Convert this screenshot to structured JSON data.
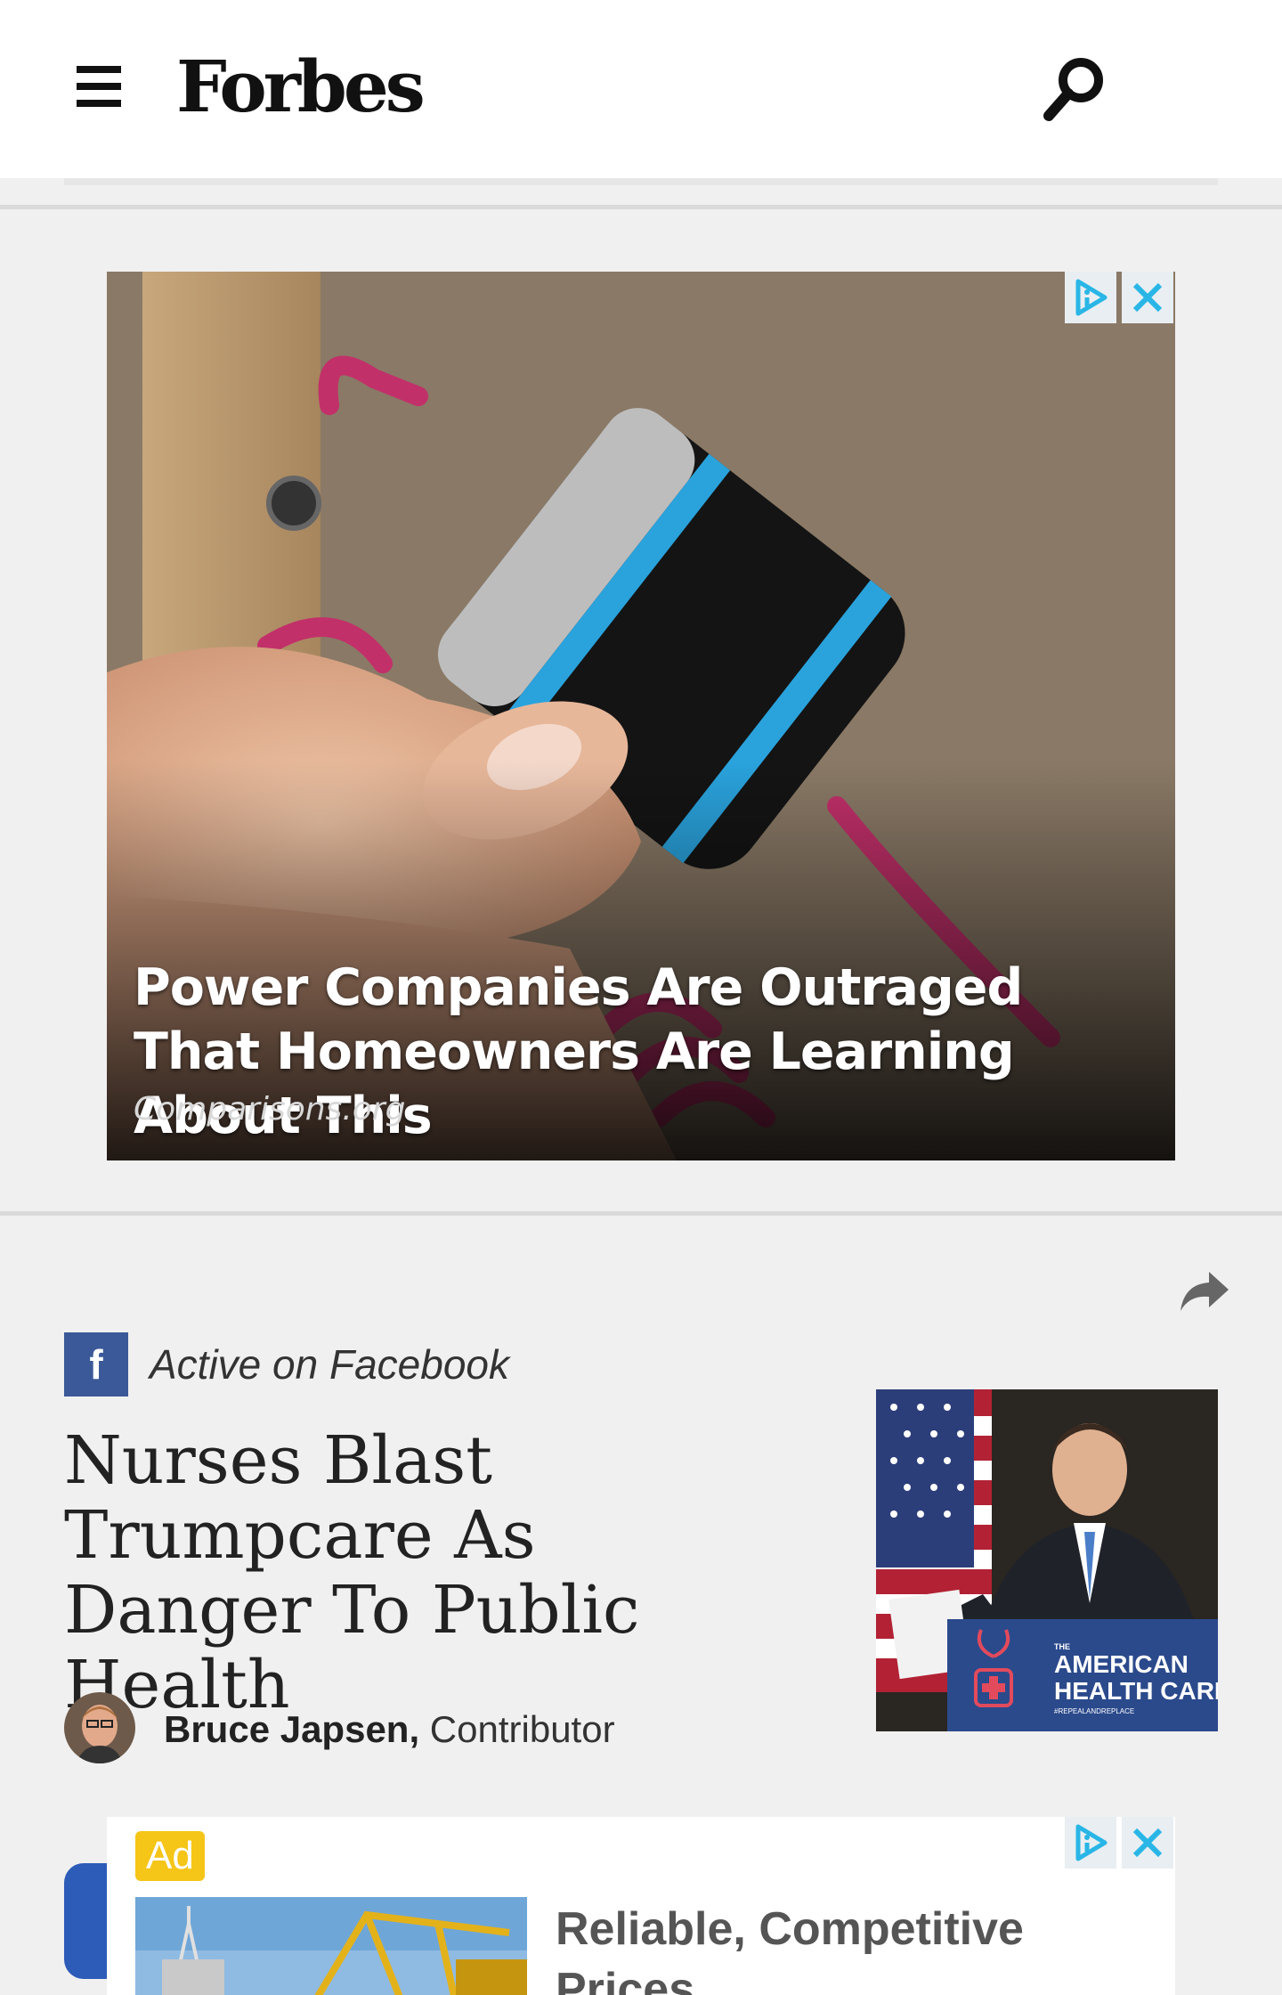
{
  "header": {
    "logo_text": "Forbes",
    "menu_icon": "hamburger-menu-icon",
    "search_icon": "search-icon"
  },
  "top_ad": {
    "headline": "Power Companies Are Outraged That Homeowners Are Learning About This",
    "source": "Comparisons.org",
    "adchoices_icon": "adchoices-icon",
    "close_icon": "close-icon"
  },
  "article": {
    "share_icon": "share-icon",
    "social_badge": "f",
    "social_label": "Active on Facebook",
    "title": "Nurses Blast Trumpcare As Danger To Public Health",
    "author_name": "Bruce Japsen,",
    "author_role": " Contributor",
    "thumb_sign_small": "THE",
    "thumb_sign_line1": "AMERICAN",
    "thumb_sign_line2": "HEALTH CARE",
    "thumb_sign_hashtag": "#REPEALANDREPLACE"
  },
  "bottom_ad": {
    "badge": "Ad",
    "title": "Reliable, Competitive Prices",
    "adchoices_icon": "adchoices-icon",
    "close_icon": "close-icon"
  },
  "colors": {
    "facebook_blue": "#3b5998",
    "ad_badge_yellow": "#f5c518",
    "adchoices_blue": "#29b6e6"
  }
}
